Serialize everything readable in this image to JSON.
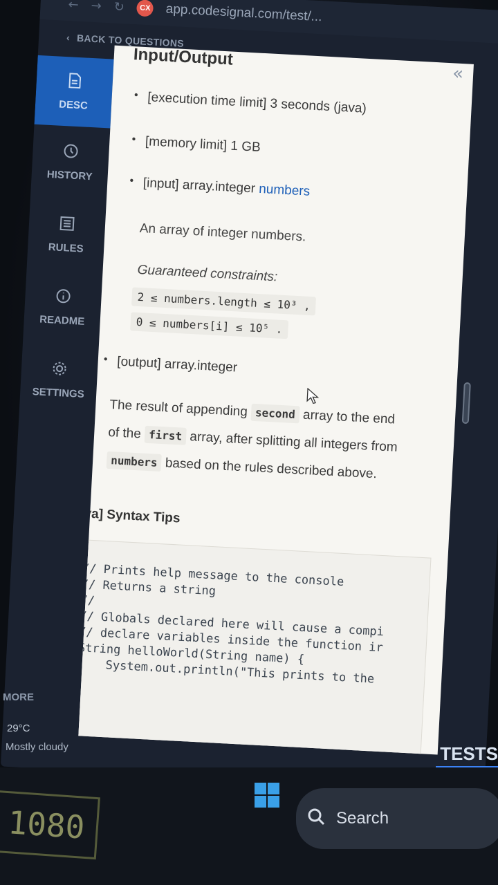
{
  "browser": {
    "url": "app.codesignal.com/test/...",
    "site_badge": "CX"
  },
  "header": {
    "back_label": "BACK TO QUESTIONS"
  },
  "sidebar": {
    "items": [
      {
        "label": "DESC",
        "icon": "document-icon"
      },
      {
        "label": "HISTORY",
        "icon": "clock-icon"
      },
      {
        "label": "RULES",
        "icon": "list-icon"
      },
      {
        "label": "README",
        "icon": "info-icon"
      },
      {
        "label": "SETTINGS",
        "icon": "gear-icon"
      }
    ]
  },
  "content": {
    "section_title": "Input/Output",
    "time_limit_tag": "[execution time limit]",
    "time_limit_value": "3 seconds (java)",
    "memory_limit_tag": "[memory limit]",
    "memory_limit_value": "1 GB",
    "input_tag": "[input]",
    "input_type": "array.integer",
    "input_name": "numbers",
    "input_desc": "An array of integer numbers.",
    "constraints_label": "Guaranteed constraints:",
    "constraint_1": "2 ≤ numbers.length ≤ 10³ ,",
    "constraint_2": "0 ≤ numbers[i] ≤ 10⁵ .",
    "output_tag": "[output]",
    "output_type": "array.integer",
    "output_desc": {
      "part1": "The result of appending",
      "code1": "second",
      "part2": "array to the end of the",
      "code2": "first",
      "part3": "array, after splitting all integers from",
      "code3": "numbers",
      "part4": "based on the rules described above."
    },
    "syntax_title": "[Java] Syntax Tips",
    "code_sample": "// Prints help message to the console\n// Returns a string\n//\n// Globals declared here will cause a compi\n// declare variables inside the function ir\nString helloWorld(String name) {\n    System.out.println(\"This prints to the"
  },
  "footer": {
    "tests_label": "TESTS"
  },
  "weather": {
    "more": "MORE",
    "temp": "29°C",
    "desc": "Mostly cloudy"
  },
  "taskbar": {
    "search_label": "Search"
  },
  "monitor": {
    "label": "1080"
  }
}
